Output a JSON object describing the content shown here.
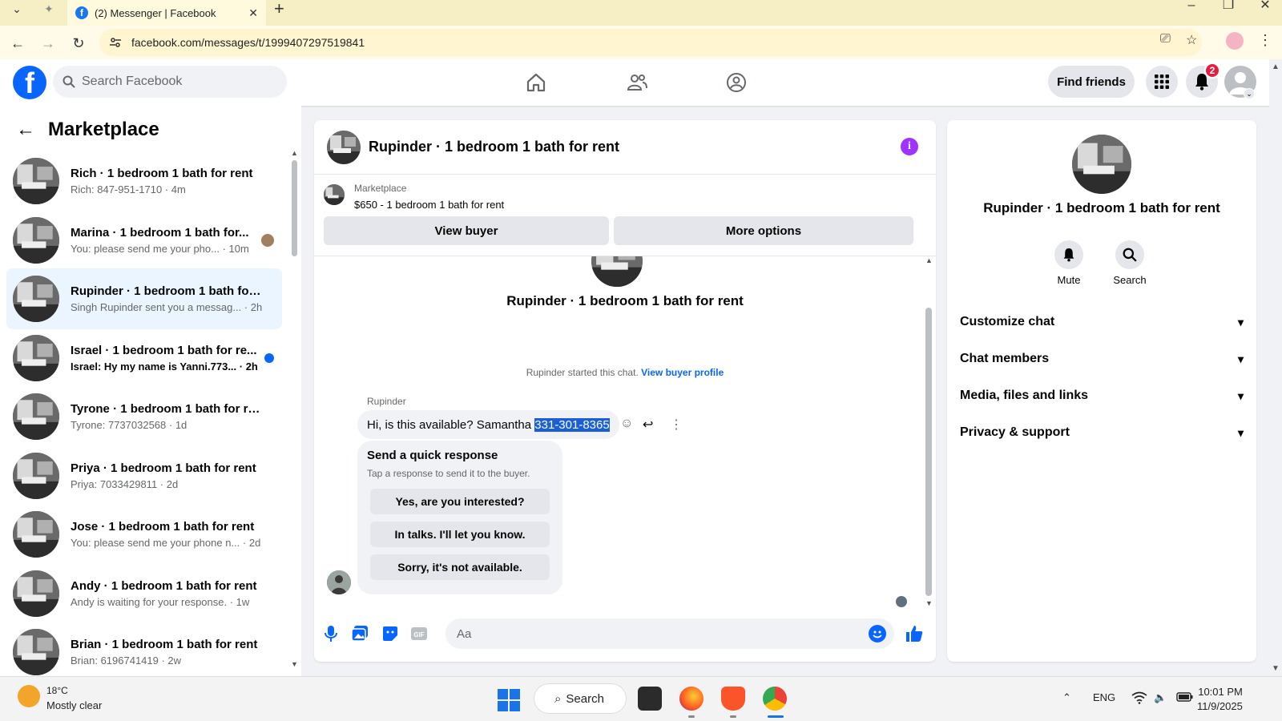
{
  "browser": {
    "tab_title": "(2) Messenger | Facebook",
    "url": "facebook.com/messages/t/1999407297519841"
  },
  "header": {
    "logo_letter": "f",
    "search_placeholder": "Search Facebook",
    "find_friends_label": "Find friends",
    "notification_count": "2"
  },
  "sidebar": {
    "back_icon": "←",
    "title": "Marketplace",
    "conversations": [
      {
        "title": "Rich · 1 bedroom 1 bath for rent",
        "snippet": "Rich: 847-951-1710 · 4m",
        "unread": false
      },
      {
        "title": "Marina · 1 bedroom 1 bath for...",
        "snippet": "You: please send me your pho... · 10m",
        "unread": false
      },
      {
        "title": "Rupinder · 1 bedroom 1 bath for ...",
        "snippet": "Singh Rupinder sent you a messag... · 2h",
        "unread": false
      },
      {
        "title": "Israel · 1 bedroom 1 bath for re...",
        "snippet": "Israel: Hy my name is Yanni.773... · 2h",
        "unread": true
      },
      {
        "title": "Tyrone · 1 bedroom 1 bath for rent",
        "snippet": "Tyrone: 7737032568 · 1d",
        "unread": false
      },
      {
        "title": "Priya · 1 bedroom 1 bath for rent",
        "snippet": "Priya: 7033429811 · 2d",
        "unread": false
      },
      {
        "title": "Jose · 1 bedroom 1 bath for rent",
        "snippet": "You: please send me your phone n... · 2d",
        "unread": false
      },
      {
        "title": "Andy · 1 bedroom 1 bath for rent",
        "snippet": "Andy is waiting for your response. · 1w",
        "unread": false
      },
      {
        "title": "Brian · 1 bedroom 1 bath for rent",
        "snippet": "Brian: 6196741419 · 2w",
        "unread": false
      }
    ]
  },
  "chat": {
    "title": "Rupinder · 1 bedroom 1 bath for rent",
    "info_icon": "i",
    "marketplace_label": "Marketplace",
    "listing": "$650 - 1 bedroom 1 bath for rent",
    "view_buyer_label": "View buyer",
    "more_options_label": "More options",
    "started_text": "Rupinder started this chat.",
    "view_profile_link": "View buyer profile",
    "sender": "Rupinder",
    "message_prefix": "Hi, is this available? Samantha ",
    "message_highlight": "331-301-8365",
    "quick_title": "Send a quick response",
    "quick_subtitle": "Tap a response to send it to the buyer.",
    "quick_responses": [
      "Yes, are you interested?",
      "In talks. I'll let you know.",
      "Sorry, it's not available."
    ],
    "composer_placeholder": "Aa"
  },
  "details": {
    "name": "Rupinder · 1 bedroom 1 bath for rent",
    "mute_label": "Mute",
    "search_label": "Search",
    "sections": [
      "Customize chat",
      "Chat members",
      "Media, files and links",
      "Privacy & support"
    ]
  },
  "taskbar": {
    "temperature": "18°C",
    "weather": "Mostly clear",
    "search_label": "Search",
    "language": "ENG",
    "time": "10:01 PM",
    "date": "11/9/2025"
  },
  "colors": {
    "brand_blue": "#0866ff",
    "info_purple": "#a033ff",
    "chrome_yellow": "#f6efc6"
  }
}
